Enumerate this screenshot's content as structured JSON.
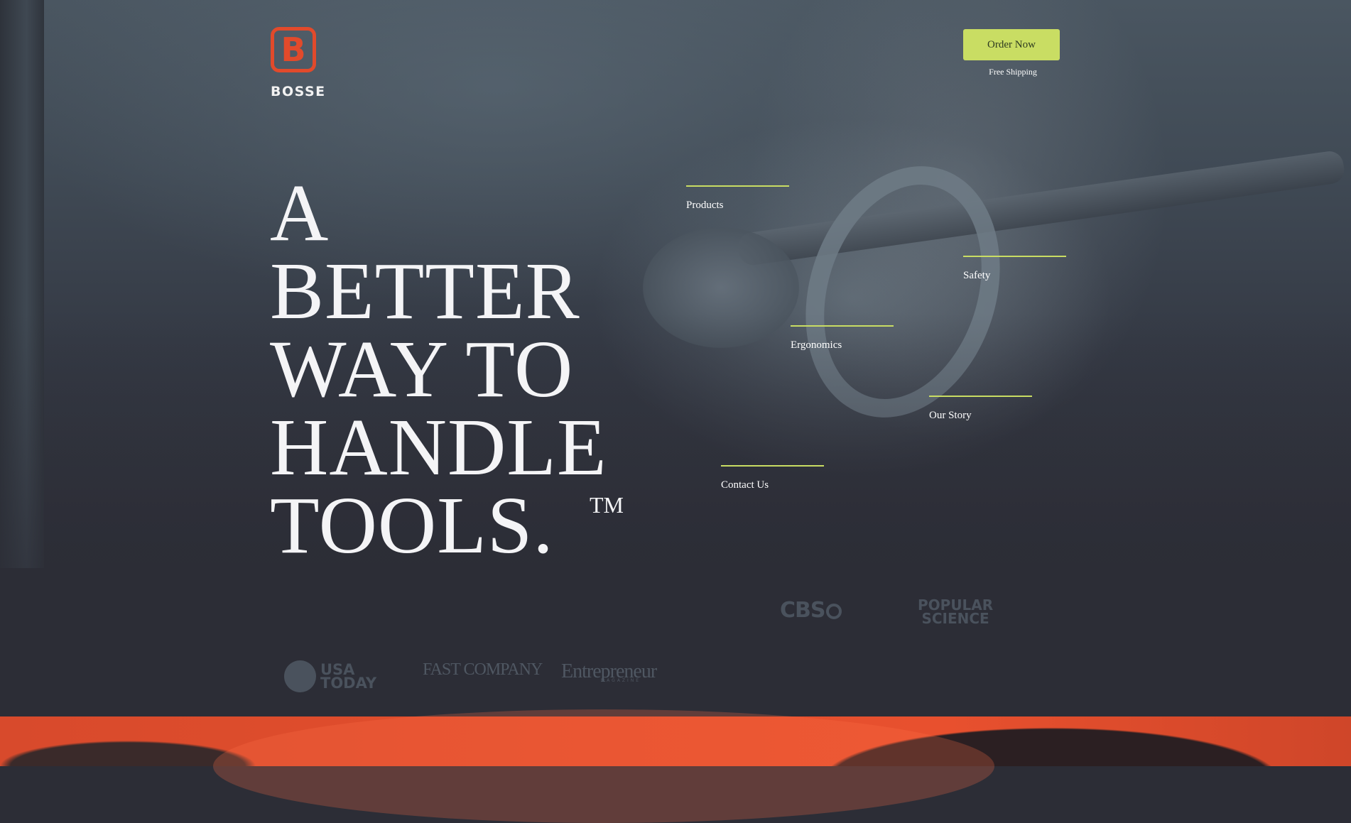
{
  "brand": {
    "name": "BOSSE",
    "logo_letter": "B",
    "accent_color": "#e24a2b"
  },
  "header": {
    "order_button": "Order Now",
    "shipping_note": "Free Shipping",
    "button_color": "#c9dd63"
  },
  "hero": {
    "headline_lines": [
      "A",
      "BETTER",
      "WAY TO",
      "HANDLE",
      "TOOLS."
    ],
    "trademark": "TM"
  },
  "nav": {
    "products": "Products",
    "safety": "Safety",
    "ergonomics": "Ergonomics",
    "our_story": "Our Story",
    "contact_us": "Contact Us",
    "line_color": "#c9dd63"
  },
  "press": {
    "cbs": "CBS",
    "popular_science": [
      "POPULAR",
      "SCIENCE"
    ],
    "usa_today": [
      "USA",
      "TODAY"
    ],
    "fast_company": "FAST COMPANY",
    "entrepreneur": "Entrepreneur",
    "entrepreneur_sub": "MAGAZINE"
  }
}
